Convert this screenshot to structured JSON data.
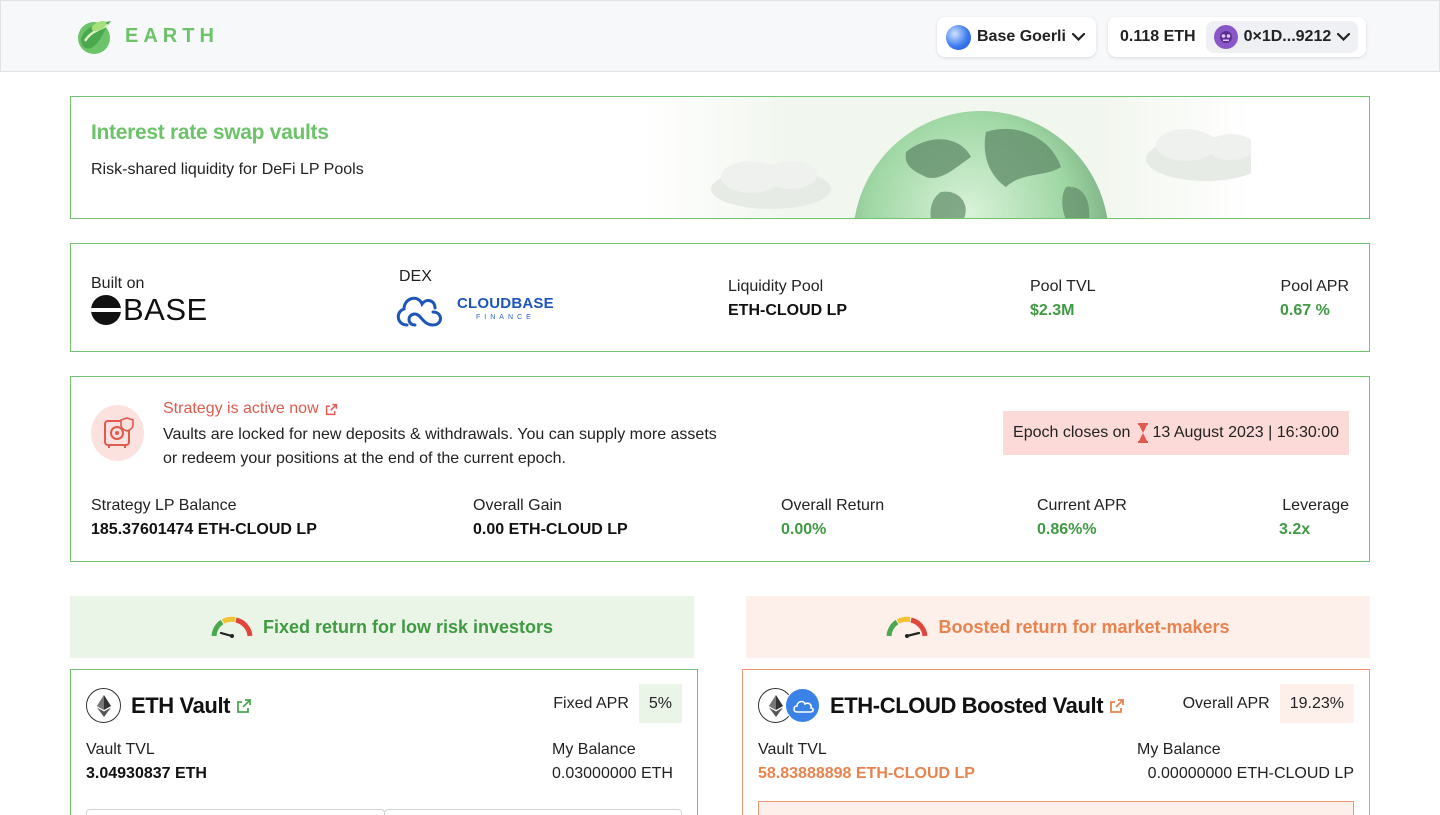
{
  "header": {
    "logo_text": "EARTH",
    "network_label": "Base Goerli",
    "balance": "0.118 ETH",
    "account_address": "0×1D...9212"
  },
  "hero": {
    "title": "Interest rate swap vaults",
    "subtitle": "Risk-shared liquidity for DeFi LP Pools"
  },
  "info": {
    "built_on_label": "Built on",
    "built_on_value": "BASE",
    "dex_label": "DEX",
    "dex_name": "CLOUDBASE",
    "dex_sub": "FINANCE",
    "pool_label": "Liquidity Pool",
    "pool_value": "ETH-CLOUD LP",
    "tvl_label": "Pool TVL",
    "tvl_value": "$2.3M",
    "apr_label": "Pool APR",
    "apr_value": "0.67 %"
  },
  "strategy": {
    "status": "Strategy is active now",
    "description": "Vaults are locked for new deposits & withdrawals. You can supply more assets or redeem your positions at the end of the current epoch.",
    "epoch_prefix": "Epoch closes on",
    "epoch_date": "13 August 2023 | 16:30:00",
    "stats": [
      {
        "label": "Strategy LP Balance",
        "value": "185.37601474 ETH-CLOUD LP"
      },
      {
        "label": "Overall Gain",
        "value": "0.00 ETH-CLOUD LP"
      },
      {
        "label": "Overall Return",
        "value": "0.00%"
      },
      {
        "label": "Current APR",
        "value": "0.86%%"
      },
      {
        "label": "Leverage",
        "value": "3.2x"
      }
    ]
  },
  "low_risk": {
    "tag": "Fixed return for low risk investors",
    "vault_name": "ETH Vault",
    "apr_label": "Fixed APR",
    "apr_value": "5%",
    "tvl_label": "Vault TVL",
    "tvl_value": "3.04930837 ETH",
    "balance_label": "My Balance",
    "balance_value": "0.03000000 ETH"
  },
  "high_risk": {
    "tag": "Boosted return for market-makers",
    "vault_name": "ETH-CLOUD Boosted Vault",
    "apr_label": "Overall APR",
    "apr_value": "19.23%",
    "tvl_label": "Vault TVL",
    "tvl_value": "58.83888898 ETH-CLOUD LP",
    "balance_label": "My Balance",
    "balance_value": "0.00000000 ETH-CLOUD LP"
  },
  "colors": {
    "brand_green": "#6cc36a",
    "value_green": "#3f9a42",
    "alert_red": "#e05a4e",
    "boost_orange": "#e8834e"
  },
  "icons": [
    "earth-logo-icon",
    "network-icon",
    "chevron-down-icon",
    "avatar-icon",
    "base-logo-icon",
    "cloudbase-logo-icon",
    "safe-icon",
    "external-link-icon",
    "hourglass-icon",
    "gauge-icon",
    "eth-coin-icon",
    "cloud-coin-icon"
  ]
}
